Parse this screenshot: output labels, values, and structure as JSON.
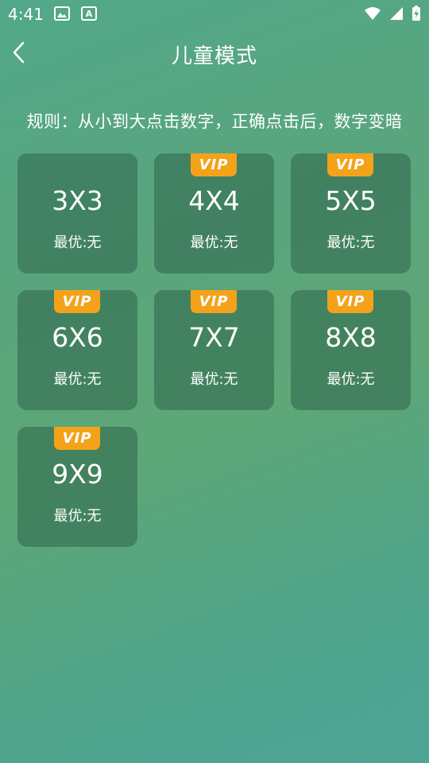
{
  "status_bar": {
    "time": "4:41",
    "left_icons": [
      "image-icon",
      "font-icon"
    ],
    "right_icons": [
      "wifi-icon",
      "signal-icon",
      "battery-icon"
    ]
  },
  "header": {
    "title": "儿童模式",
    "back_icon": "chevron-left-icon"
  },
  "rules": "规则：从小到大点击数字，正确点击后，数字变暗",
  "levels": [
    {
      "size": "3X3",
      "best": "最优:无",
      "vip": false
    },
    {
      "size": "4X4",
      "best": "最优:无",
      "vip": true,
      "badge": "VIP"
    },
    {
      "size": "5X5",
      "best": "最优:无",
      "vip": true,
      "badge": "VIP"
    },
    {
      "size": "6X6",
      "best": "最优:无",
      "vip": true,
      "badge": "VIP"
    },
    {
      "size": "7X7",
      "best": "最优:无",
      "vip": true,
      "badge": "VIP"
    },
    {
      "size": "8X8",
      "best": "最优:无",
      "vip": true,
      "badge": "VIP"
    },
    {
      "size": "9X9",
      "best": "最优:无",
      "vip": true,
      "badge": "VIP"
    }
  ],
  "colors": {
    "vip_badge": "#f4a21a",
    "card_bg": "#3f7a5e",
    "text": "#ffffff"
  }
}
